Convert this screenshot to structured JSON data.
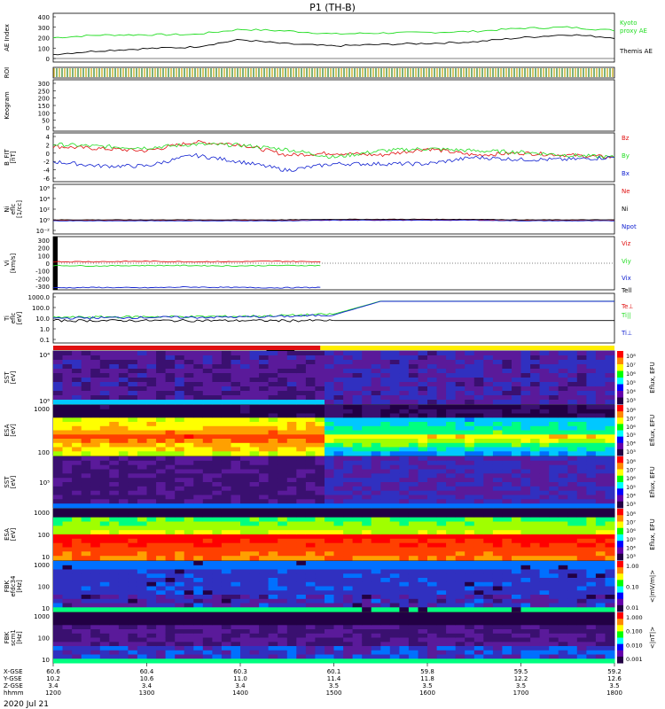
{
  "title": "P1 (TH-B)",
  "date_label": "2020 Jul 21",
  "colors": {
    "green": "#22dd22",
    "red": "#e01010",
    "blue": "#1020d0",
    "black": "#000000",
    "yellow": "#ffee00",
    "darkbg": "#1a0830"
  },
  "footer": {
    "row_labels": [
      "X-GSE",
      "Y-GSE",
      "Z-GSE",
      "hhmm"
    ],
    "ticks": [
      {
        "hhmm": "1200",
        "x": "60.6",
        "y": "10.2",
        "z": "3.4"
      },
      {
        "hhmm": "1300",
        "x": "60.4",
        "y": "10.6",
        "z": "3.4"
      },
      {
        "hhmm": "1400",
        "x": "60.3",
        "y": "11.0",
        "z": "3.4"
      },
      {
        "hhmm": "1500",
        "x": "60.1",
        "y": "11.4",
        "z": "3.5"
      },
      {
        "hhmm": "1600",
        "x": "59.8",
        "y": "11.8",
        "z": "3.5"
      },
      {
        "hhmm": "1700",
        "x": "59.5",
        "y": "12.2",
        "z": "3.5"
      },
      {
        "hhmm": "1800",
        "x": "59.2",
        "y": "12.6",
        "z": "3.5"
      }
    ]
  },
  "chart_data": [
    {
      "type": "line",
      "ylabel": "AE Index",
      "yticks": [
        "400",
        "300",
        "200",
        "100",
        "0"
      ],
      "ylim": [
        0,
        400
      ],
      "x": [
        "1200",
        "1230",
        "1300",
        "1330",
        "1400",
        "1430",
        "1500",
        "1530",
        "1600",
        "1630",
        "1700",
        "1730",
        "1800"
      ],
      "series": [
        {
          "name": "Kyoto proxy AE",
          "values": [
            200,
            225,
            228,
            230,
            280,
            265,
            235,
            245,
            250,
            260,
            290,
            300,
            270
          ]
        },
        {
          "name": "Themis AE",
          "values": [
            40,
            75,
            95,
            110,
            180,
            140,
            120,
            135,
            145,
            160,
            200,
            230,
            200
          ]
        }
      ]
    },
    {
      "type": "bar",
      "ylabel": "ROI",
      "values": []
    },
    {
      "type": "heatmap",
      "ylabel": "Keogram",
      "yticks": [
        "300",
        "250",
        "200",
        "150",
        "100",
        "50",
        "0"
      ],
      "ylim": [
        0,
        300
      ]
    },
    {
      "type": "line",
      "ylabel": "B_FIT\n[nT]",
      "yticks": [
        "4",
        "2",
        "0",
        "-2",
        "-4",
        "-6"
      ],
      "ylim": [
        -6,
        4
      ],
      "series": [
        {
          "name": "Bz",
          "values": [
            1.5,
            1.0,
            0.5,
            2.5,
            2.0,
            -0.5,
            0.0,
            -0.5,
            1.0,
            -0.5,
            0.0,
            -0.5,
            -1.0
          ]
        },
        {
          "name": "By",
          "values": [
            2.0,
            1.5,
            1.2,
            2.0,
            1.8,
            0.8,
            -1.0,
            0.5,
            1.0,
            0.5,
            0.2,
            -0.5,
            -1.0
          ]
        },
        {
          "name": "Bx",
          "values": [
            -2.0,
            -3.0,
            -3.0,
            -0.5,
            -2.0,
            -4.0,
            -2.5,
            -2.5,
            -2.5,
            -1.0,
            -1.5,
            -1.5,
            -1.0
          ]
        }
      ]
    },
    {
      "type": "line",
      "ylabel": "Ni\neflc\n[1/cc]",
      "yticks": [
        "10⁶",
        "10⁴",
        "10²",
        "10⁰",
        "10⁻²"
      ],
      "ylim": [
        -2,
        6
      ],
      "series": [
        {
          "name": "Ne",
          "values": [
            -0.1,
            -0.1,
            -0.1,
            -0.1,
            -0.1,
            -0.1,
            0.0,
            0.0,
            0.0,
            0.0,
            -0.1,
            -0.1,
            -0.1
          ]
        },
        {
          "name": "Ni",
          "values": [
            0.0,
            0.0,
            0.0,
            0.0,
            0.0,
            0.0,
            0.1,
            0.1,
            0.1,
            0.1,
            0.0,
            0.0,
            0.0
          ]
        },
        {
          "name": "Npot",
          "values": [
            -0.2,
            -0.2,
            -0.2,
            -0.2,
            -0.2,
            -0.2,
            -0.1,
            -0.1,
            -0.1,
            -0.1,
            -0.2,
            -0.2,
            -0.2
          ]
        }
      ]
    },
    {
      "type": "line",
      "ylabel": "Vi\n[km/s]",
      "yticks": [
        "300",
        "200",
        "100",
        "0",
        "-100",
        "-200",
        "-300"
      ],
      "ylim": [
        -300,
        300
      ],
      "series": [
        {
          "name": "Viz",
          "values": [
            20,
            20,
            25,
            20,
            20,
            25,
            20
          ]
        },
        {
          "name": "Viy",
          "values": [
            -30,
            -35,
            -30,
            -30,
            -35,
            -30,
            -30
          ]
        },
        {
          "name": "Vix",
          "values": [
            -320,
            -315,
            -320,
            -310,
            -315,
            -320,
            -315
          ]
        },
        {
          "name": "Tell",
          "values": []
        }
      ]
    },
    {
      "type": "line",
      "ylabel": "Ti\neflc\n[eV]",
      "yticks": [
        "1000.0",
        "100.0",
        "10.0",
        "1.0",
        "0.1"
      ],
      "ylim": [
        0.1,
        1000
      ],
      "yscale": "log",
      "series": [
        {
          "name": "Te⊥",
          "values": [
            6,
            6,
            6,
            6,
            6,
            6,
            6,
            6,
            6,
            6,
            6,
            6,
            6
          ]
        },
        {
          "name": "Ti||",
          "values": [
            12,
            13,
            14,
            14,
            15,
            18,
            24,
            400,
            400,
            400,
            400,
            400,
            400
          ]
        },
        {
          "name": "Ti⊥",
          "values": [
            10,
            11,
            12,
            12,
            13,
            15,
            20,
            380,
            380,
            380,
            380,
            380,
            380
          ]
        }
      ]
    },
    {
      "type": "heatmap",
      "ylabel": "SST\n[eV]",
      "yticks": [
        "10⁴",
        "10⁶"
      ],
      "colorbar_label": "Eflux, EFU"
    },
    {
      "type": "heatmap",
      "ylabel": "ESA\n[eV]",
      "yticks": [
        "1000",
        "100"
      ],
      "colorbar_label": "Eflux, EFU"
    },
    {
      "type": "heatmap",
      "ylabel": "SST\n[eV]",
      "yticks": [
        "10⁵"
      ],
      "colorbar_label": "Eflux, EFU"
    },
    {
      "type": "heatmap",
      "ylabel": "ESA\n[eV]",
      "yticks": [
        "1000",
        "100",
        "10"
      ],
      "colorbar_label": "Eflux, EFU"
    },
    {
      "type": "heatmap",
      "ylabel": "FBK\nefdc34\n[Hz]",
      "yticks": [
        "1000",
        "100",
        "10"
      ],
      "colorbar_label": "<|mV/m|>",
      "colorbar_ticks": [
        "1.00",
        "0.10",
        "0.01"
      ]
    },
    {
      "type": "heatmap",
      "ylabel": "FBK\nscm1\n[Hz]",
      "yticks": [
        "1000",
        "100",
        "10"
      ],
      "colorbar_label": "<|nT|>",
      "colorbar_ticks": [
        "1.000",
        "0.100",
        "0.010",
        "0.001"
      ]
    }
  ],
  "colorbar_eflux_ticks": [
    "10⁸",
    "10⁷",
    "10⁶",
    "10⁵",
    "10⁴",
    "10³"
  ]
}
